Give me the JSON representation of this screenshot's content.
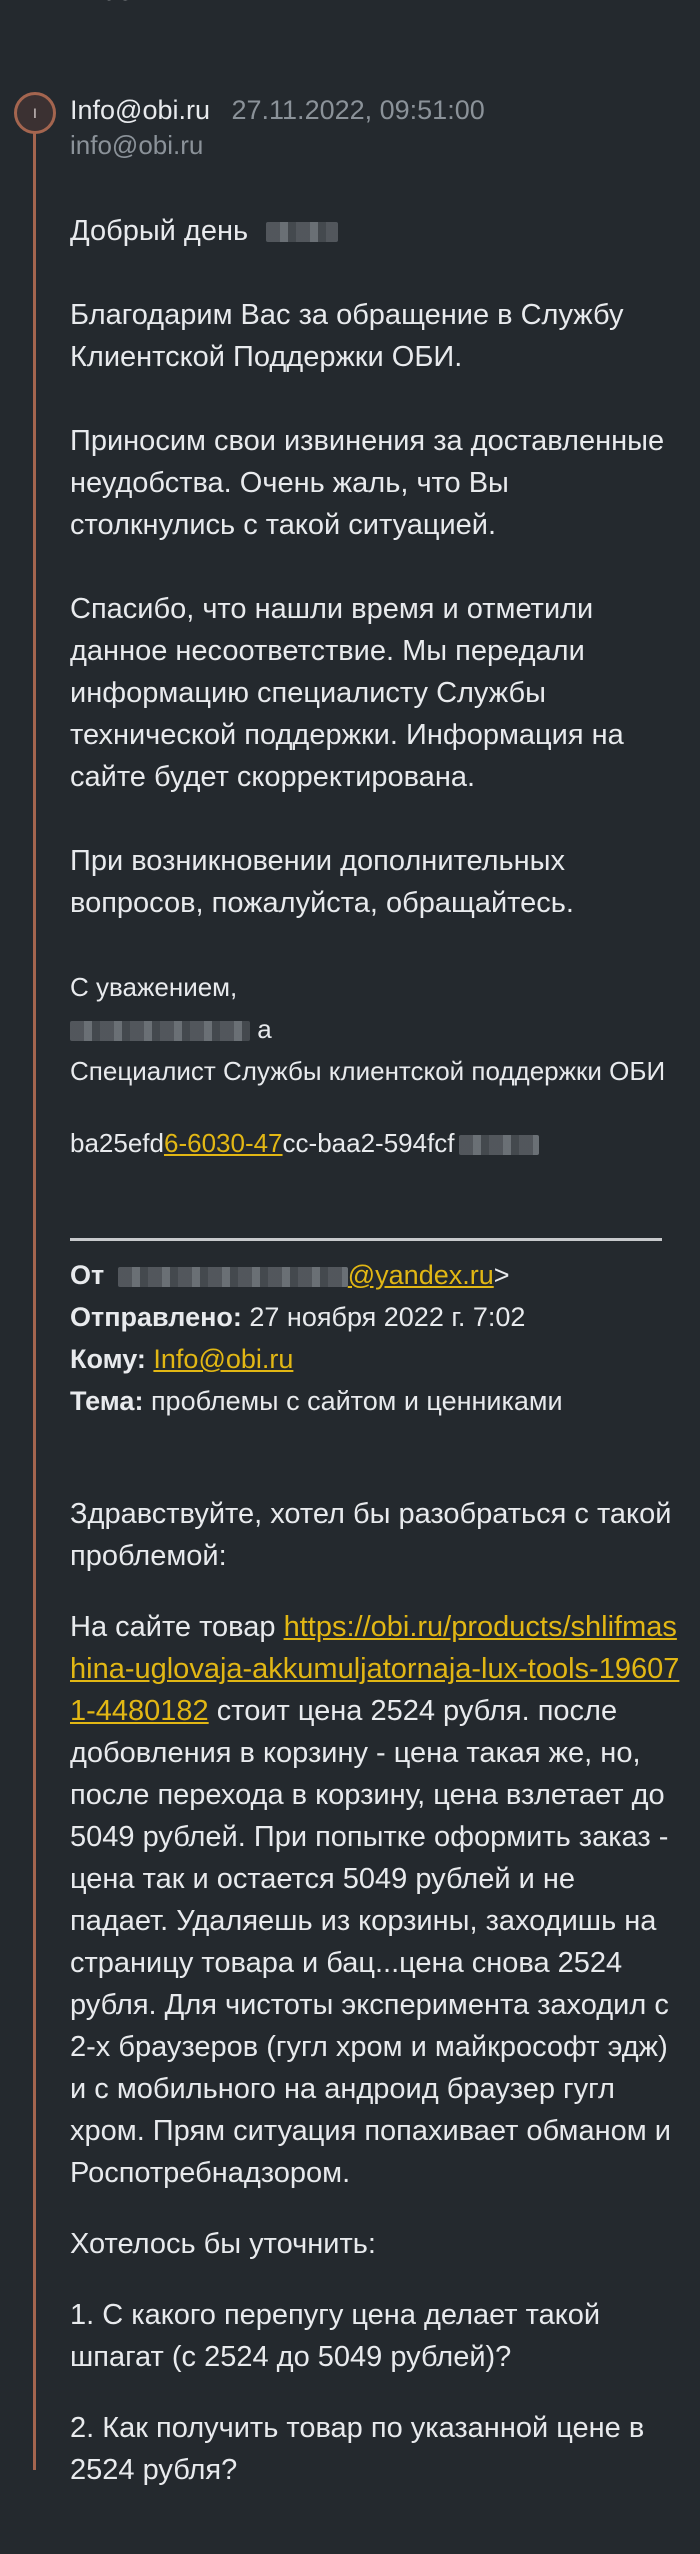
{
  "top_cut_text": "…бей...",
  "message": {
    "avatar_letter": "I",
    "sender_name": "Info@obi.ru",
    "timestamp": "27.11.2022, 09:51:00",
    "sender_email": "info@obi.ru",
    "greeting": "Добрый день",
    "paragraphs": [
      "Благодарим Вас за обращение в Службу Клиентской Поддержки ОБИ.",
      "Приносим свои извинения за доставленные неудобства. Очень жаль, что Вы столкнулись с такой ситуацией.",
      "Спасибо, что нашли время и отметили данное несоответствие. Мы передали информацию специалисту Службы технической поддержки.  Информация на сайте будет скорректирована.",
      "При возникновении дополнительных вопросов, пожалуйста, обращайтесь."
    ],
    "signature": {
      "regards": "С уважением,",
      "name_suffix": "а",
      "role": "Специалист Службы клиентской поддержки ОБИ"
    },
    "ticket": {
      "prefix": "ba25efd",
      "link": "6-6030-47",
      "suffix": "cc-baa2-594fcf"
    }
  },
  "quoted": {
    "from_label": "От",
    "from_domain": "@yandex.ru",
    "from_end": ">",
    "sent_label": "Отправлено:",
    "sent_value": " 27 ноября 2022 г. 7:02",
    "to_label": "Кому:",
    "to_value": "Info@obi.ru",
    "subject_label": "Тема:",
    "subject_value": " проблемы с сайтом и ценниками",
    "body_intro": "Здравствуйте, хотел бы разобраться с такой проблемой:",
    "body_product_prefix": "На сайте товар ",
    "body_link": "https://obi.ru/products/shlifmashina-uglovaja-akkumuljatornaja-lux-tools-196071-4480182",
    "body_main": " стоит цена 2524 рубля. после добовления в корзину - цена такая же, но, после перехода в корзину, цена взлетает до 5049 рублей. При попытке оформить заказ - цена так и остается 5049 рублей и не падает. Удаляешь из корзины, заходишь на страницу товара и бац...цена снова 2524 рубля. Для чистоты эксперимента заходил с 2-х браузеров (гугл хром и майкрософт эдж) и с мобильного на андроид браузер гугл хром.  Прям ситуация попахивает обманом и Роспотребнадзором.",
    "body_question_intro": "Хотелось бы уточнить:",
    "body_q1": "1. С какого перепугу цена делает такой шпагат (с 2524 до 5049 рублей)?",
    "body_q2": "2. Как получить товар по указанной цене в 2524 рубля?"
  }
}
